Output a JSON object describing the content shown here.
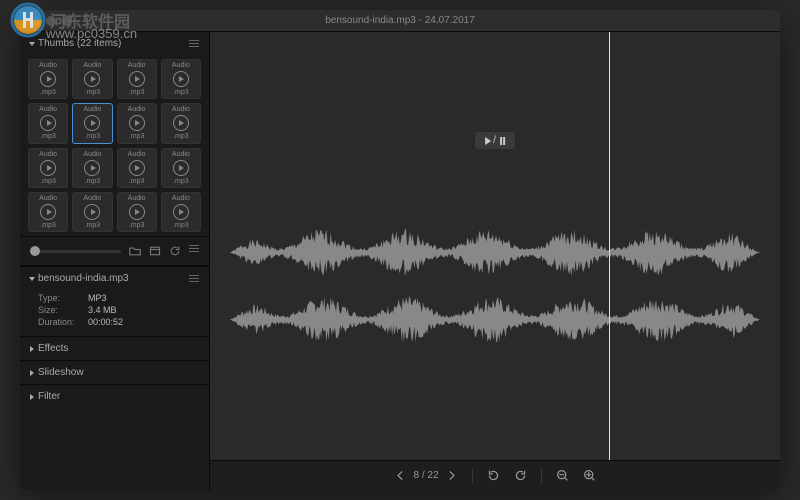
{
  "titlebar": {
    "title": "bensound-india.mp3 - 24.07.2017"
  },
  "sidebar": {
    "thumbs": {
      "header": "Thumbs (22 items)",
      "item_top": "Audio",
      "item_bottom": ".mp3",
      "selected_index": 5
    },
    "info": {
      "filename": "bensound-india.mp3",
      "rows": [
        {
          "label": "Type:",
          "value": "MP3"
        },
        {
          "label": "Size:",
          "value": "3.4 MB"
        },
        {
          "label": "Duration:",
          "value": "00:00:52"
        }
      ]
    },
    "panels": {
      "effects": "Effects",
      "slideshow": "Slideshow",
      "filter": "Filter"
    }
  },
  "main": {
    "play_pause": "/",
    "page_indicator": "8 / 22"
  },
  "watermark": {
    "text": "河东软件园",
    "url": "www.pc0359.cn"
  }
}
